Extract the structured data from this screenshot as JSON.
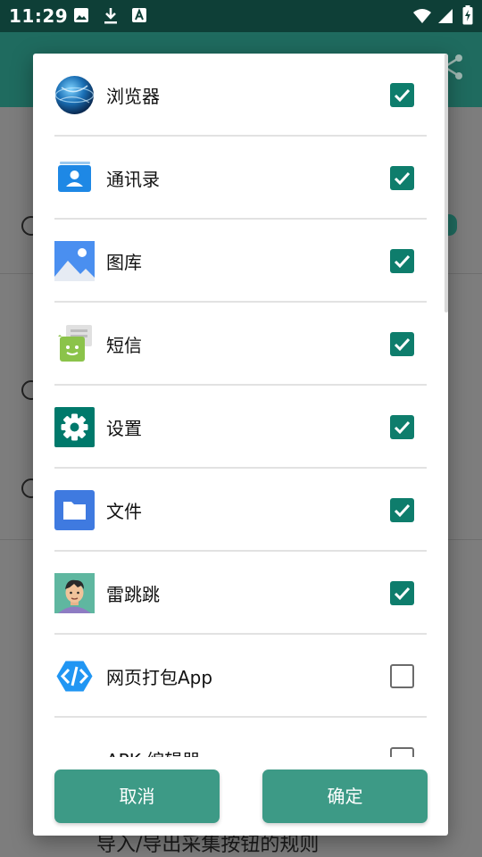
{
  "status_bar": {
    "time": "11:29",
    "icons": [
      "image-icon",
      "download-icon",
      "font-icon",
      "wifi-icon",
      "signal-icon",
      "battery-charging-icon"
    ]
  },
  "background": {
    "bottom_text": "导入/导出采集按钮的规则"
  },
  "dialog": {
    "items": [
      {
        "label": "浏览器",
        "icon": "browser-globe-icon",
        "checked": true
      },
      {
        "label": "通讯录",
        "icon": "contacts-icon",
        "checked": true
      },
      {
        "label": "图库",
        "icon": "gallery-icon",
        "checked": true
      },
      {
        "label": "短信",
        "icon": "messaging-icon",
        "checked": true
      },
      {
        "label": "设置",
        "icon": "settings-gear-icon",
        "checked": true
      },
      {
        "label": "文件",
        "icon": "files-folder-icon",
        "checked": true
      },
      {
        "label": "雷跳跳",
        "icon": "avatar-app-icon",
        "checked": true
      },
      {
        "label": "网页打包App",
        "icon": "code-app-icon",
        "checked": false
      },
      {
        "label": "APK 编辑器",
        "icon": "apk-editor-icon",
        "checked": false
      }
    ],
    "cancel_label": "取消",
    "confirm_label": "确定"
  },
  "colors": {
    "accent": "#0e7d6c",
    "button": "#3d9a86",
    "status_bar": "#0e3f37"
  }
}
